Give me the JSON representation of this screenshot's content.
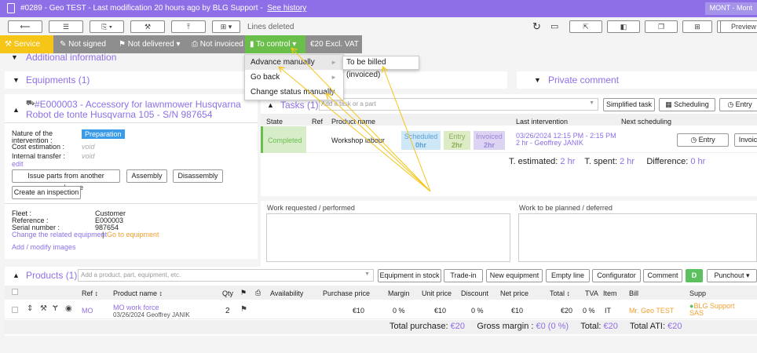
{
  "titlebar": {
    "text": "#0289  -  Geo TEST  -  Last modification 20 hours ago by BLG Support  -",
    "link": "See history",
    "badge": "MONT - Mont"
  },
  "toolbar": {
    "lines_deleted": "Lines deleted",
    "preview": "Preview"
  },
  "statusbar": {
    "service": "Service",
    "not_signed": "Not signed",
    "not_delivered": "Not delivered",
    "not_invoiced": "Not invoiced",
    "to_control": "To control",
    "amount": "€20 Excl. VAT"
  },
  "menu": {
    "items": [
      "Advance manually",
      "Go back",
      "Change status manually"
    ],
    "submenu": "To be billed (invoiced)"
  },
  "sections": {
    "additional_info": "Additional information",
    "equipments": "Equipments (1)",
    "private_comment": "Private comment"
  },
  "equipment": {
    "title_line1": "#E000003 - Accessory for lawnmower Husqvarna",
    "title_line2": "Robot de tonte Husqvarna 105 - S/N 987654",
    "nature_label": "Nature of the intervention :",
    "nature_value": "Preparation",
    "cost_label": "Cost estimation :",
    "cost_value": "void",
    "transfer_label": "Internal transfer :",
    "transfer_value": "void",
    "edit": "edit",
    "btn_issue": "Issue parts from another warehouse",
    "btn_assembly": "Assembly",
    "btn_disassembly": "Disassembly",
    "btn_inspection": "Create an inspection",
    "fleet_label": "Fleet :",
    "fleet_value": "Customer",
    "ref_label": "Reference :",
    "ref_value": "E000003",
    "serial_label": "Serial number :",
    "serial_value": "987654",
    "change_link": "Change the related equipment",
    "sep": "|",
    "goto_link": "Go to equipment",
    "images_link": "Add / modify images"
  },
  "tasks": {
    "title": "Tasks (1)",
    "input_placeholder": "Add a task or a part",
    "btn_simplified": "Simplified task",
    "btn_scheduling": "Scheduling",
    "btn_entry": "Entry",
    "headers": [
      "State",
      "Ref",
      "Product name",
      "Last intervention",
      "Next scheduling"
    ],
    "row": {
      "state": "Completed",
      "name": "Workshop labour",
      "scheduled_label": "Scheduled",
      "scheduled_value": "0hr",
      "entry_label": "Entry",
      "entry_value": "2hr",
      "invoiced_label": "Invoiced",
      "invoiced_value": "2hr",
      "last_line1": "03/26/2024 12:15 PM - 2:15 PM",
      "last_line2": "2 hr - Geoffrey JANIK",
      "btn_entry": "Entry",
      "btn_invoice": "Invoice"
    },
    "estimated_label": "T. estimated:",
    "estimated_value": "2 hr",
    "spent_label": "T. spent:",
    "spent_value": "2 hr",
    "difference_label": "Difference:",
    "difference_value": "0 hr"
  },
  "work": {
    "requested": "Work requested / performed",
    "planned": "Work to be planned / deferred"
  },
  "products": {
    "title": "Products (1)",
    "input_placeholder": "Add a product, part, equipment, etc.",
    "buttons": [
      "Equipment in stock",
      "Trade-in",
      "New equipment",
      "Empty line",
      "Configurator",
      "Comment",
      "D",
      "Punchout"
    ],
    "headers": [
      "Ref",
      "Product name",
      "Qty",
      "Availability",
      "Purchase price",
      "Margin",
      "Unit price",
      "Discount",
      "Net price",
      "Total",
      "TVA",
      "Item",
      "Bill",
      "Supp"
    ],
    "row": {
      "ref": "MO",
      "name": "MO work force",
      "sub": "03/26/2024 Geoffrey JANIK",
      "qty": "2",
      "purchase": "€10",
      "margin": "0 %",
      "unit": "€10",
      "discount": "0 %",
      "net": "€10",
      "total": "€20",
      "tva": "0 %",
      "item": "IT",
      "bill": "Mr. Geo TEST",
      "supp": "BLG Support SAS"
    },
    "totals": {
      "purchase_label": "Total purchase:",
      "purchase_value": "€20",
      "margin_label": "Gross margin :",
      "margin_value": "€0 (0 %)",
      "total_label": "Total:",
      "total_value": "€20",
      "ati_label": "Total ATI:",
      "ati_value": "€20"
    }
  },
  "colors": {
    "accent": "#8e6fe8",
    "service": "#f5c518",
    "status_grey": "#8e8e8e",
    "to_control": "#6abf4b",
    "orange": "#f0a030"
  }
}
